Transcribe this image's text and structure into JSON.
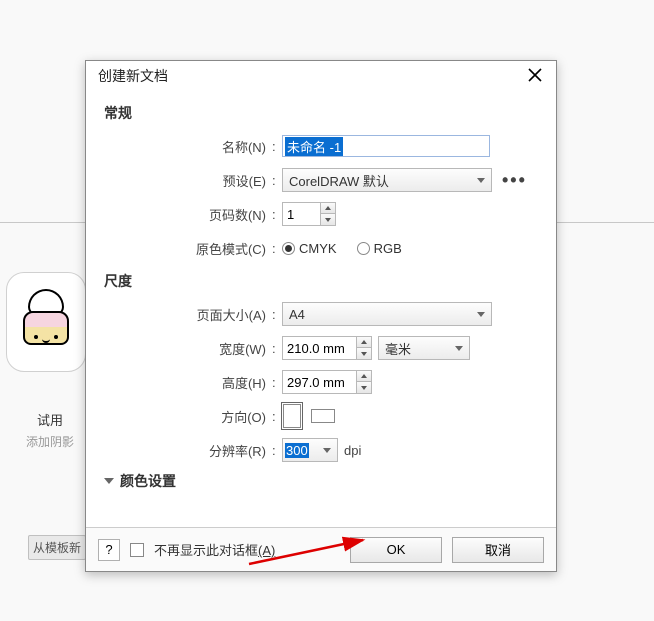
{
  "background": {
    "thumbnail_title": "试用",
    "thumbnail_subtitle": "添加阴影",
    "bg_button": "从模板新"
  },
  "dialog": {
    "title": "创建新文档",
    "sections": {
      "general": "常规",
      "dimensions": "尺度",
      "color": "颜色设置"
    },
    "rows": {
      "name_label": "名称(N)",
      "name_value": "未命名 -1",
      "preset_label": "预设(E)",
      "preset_value": "CorelDRAW 默认",
      "pages_label": "页码数(N)",
      "pages_value": "1",
      "colormode_label": "原色模式(C)",
      "cmyk": "CMYK",
      "rgb": "RGB",
      "pagesize_label": "页面大小(A)",
      "pagesize_value": "A4",
      "width_label": "宽度(W)",
      "width_value": "210.0 mm",
      "unit_value": "毫米",
      "height_label": "高度(H)",
      "height_value": "297.0 mm",
      "orient_label": "方向(O)",
      "reso_label": "分辨率(R)",
      "reso_value": "300",
      "reso_unit": "dpi"
    },
    "footer": {
      "help": "?",
      "dontshow": "不再显示此对话框",
      "dontshow_accel": "(A)",
      "ok": "OK",
      "cancel": "取消"
    },
    "more": "•••"
  }
}
